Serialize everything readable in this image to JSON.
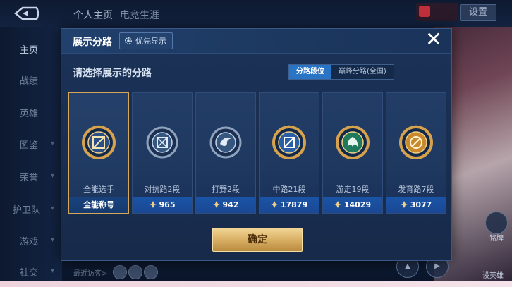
{
  "background": {
    "top_tabs": [
      "个人主页",
      "电竞生涯"
    ],
    "settings_label": "设置",
    "sidebar_items": [
      "主页",
      "战绩",
      "英雄",
      "图鉴",
      "荣誉",
      "护卫队",
      "游戏",
      "社交"
    ],
    "recent_visitors_label": "最近访客>",
    "right_labels": [
      "铭牌",
      "设英雄"
    ]
  },
  "modal": {
    "title": "展示分路",
    "priority_label": "优先显示",
    "prompt": "请选择展示的分路",
    "tabs": [
      {
        "label": "分路段位",
        "active": true
      },
      {
        "label": "巅峰分路(全国)",
        "active": false
      }
    ],
    "cards": [
      {
        "name": "全能选手",
        "footer": "全能称号",
        "selected": true,
        "badge_color": "#d6a24e",
        "badge_icon": "all-round-emblem"
      },
      {
        "name": "对抗路2段",
        "footer": "965",
        "selected": false,
        "badge_color": "#8fa3bd",
        "badge_icon": "clash-lane-emblem"
      },
      {
        "name": "打野2段",
        "footer": "942",
        "selected": false,
        "badge_color": "#8fa3bd",
        "badge_icon": "jungle-emblem"
      },
      {
        "name": "中路21段",
        "footer": "17879",
        "selected": false,
        "badge_color": "#d6a24e",
        "badge_icon": "mid-lane-emblem"
      },
      {
        "name": "游走19段",
        "footer": "14029",
        "selected": false,
        "badge_color": "#d6a24e",
        "badge_icon": "roam-emblem"
      },
      {
        "name": "发育路7段",
        "footer": "3077",
        "selected": false,
        "badge_color": "#d6a24e",
        "badge_icon": "farm-lane-emblem"
      }
    ],
    "confirm_label": "确定"
  }
}
